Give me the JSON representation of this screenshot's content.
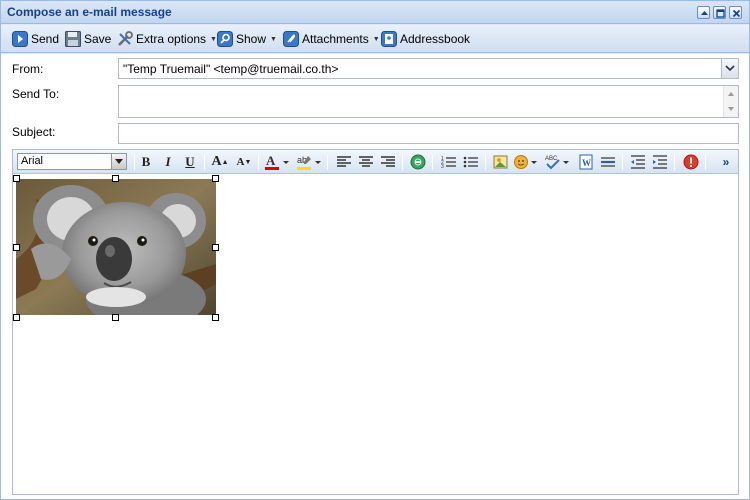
{
  "window": {
    "title": "Compose an e-mail message"
  },
  "toolbar": {
    "send_label": "Send",
    "save_label": "Save",
    "extra_options_label": "Extra options",
    "show_label": "Show",
    "attachments_label": "Attachments",
    "addressbook_label": "Addressbook"
  },
  "form": {
    "from_label": "From:",
    "from_value": "\"Temp Truemail\" <temp@truemail.co.th>",
    "send_to_label": "Send To:",
    "send_to_value": "",
    "subject_label": "Subject:",
    "subject_value": ""
  },
  "editor": {
    "font_family": "Arial",
    "image_icon": "koala-photo"
  },
  "colors": {
    "title_text": "#15428b",
    "panel_border": "#99bbe8",
    "font_color_bar": "#e00000",
    "highlight_bar": "#f2e400"
  }
}
